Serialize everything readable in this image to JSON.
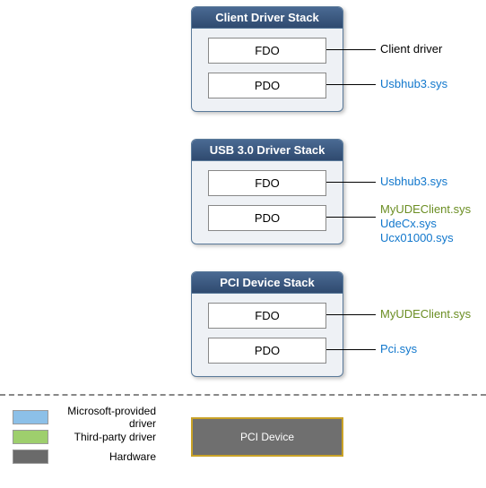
{
  "stacks": [
    {
      "title": "Client Driver Stack",
      "slots": [
        "FDO",
        "PDO"
      ],
      "labels": [
        {
          "lines": [
            {
              "text": "Client driver",
              "cls": "c-blk"
            }
          ]
        },
        {
          "lines": [
            {
              "text": "Usbhub3.sys",
              "cls": "c-ms"
            }
          ]
        }
      ]
    },
    {
      "title": "USB 3.0 Driver Stack",
      "slots": [
        "FDO",
        "PDO"
      ],
      "labels": [
        {
          "lines": [
            {
              "text": "Usbhub3.sys",
              "cls": "c-ms"
            }
          ]
        },
        {
          "lines": [
            {
              "text": "MyUDEClient.sys",
              "cls": "c-3p"
            },
            {
              "text": "UdeCx.sys",
              "cls": "c-ms"
            },
            {
              "text": "Ucx01000.sys",
              "cls": "c-ms"
            }
          ]
        }
      ]
    },
    {
      "title": "PCI Device Stack",
      "slots": [
        "FDO",
        "PDO"
      ],
      "labels": [
        {
          "lines": [
            {
              "text": "MyUDEClient.sys",
              "cls": "c-3p"
            }
          ]
        },
        {
          "lines": [
            {
              "text": "Pci.sys",
              "cls": "c-ms"
            }
          ]
        }
      ]
    }
  ],
  "legend": {
    "ms": "Microsoft-provided driver",
    "tp": "Third-party driver",
    "hw": "Hardware"
  },
  "pciDevice": "PCI Device"
}
